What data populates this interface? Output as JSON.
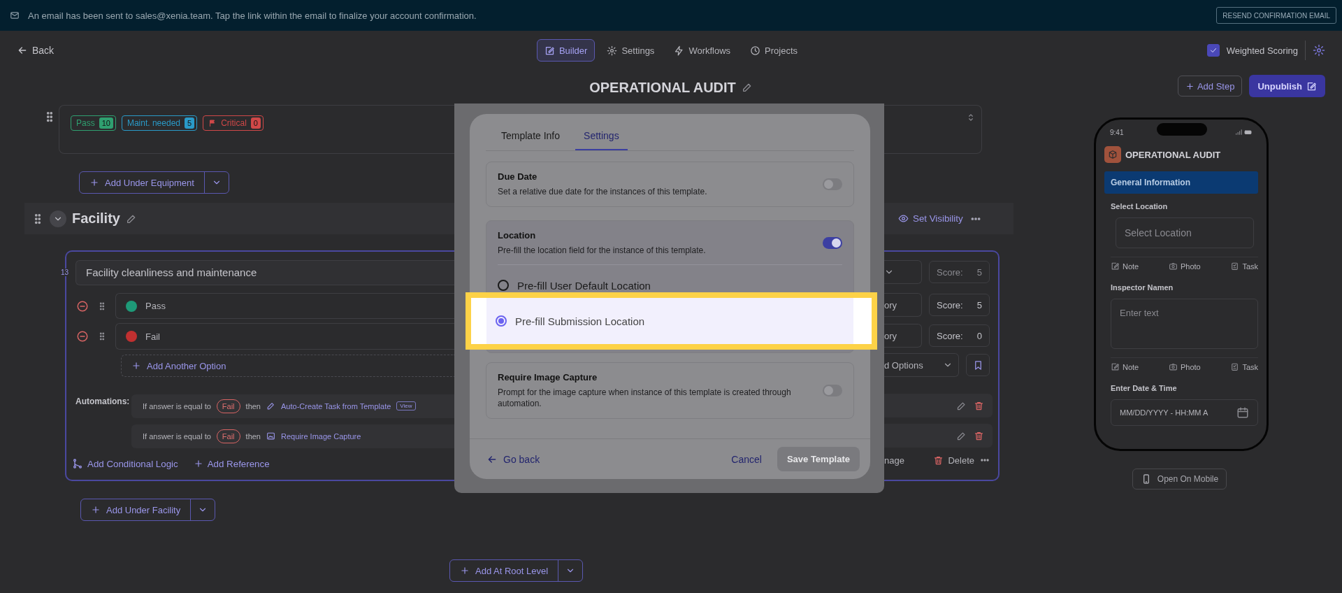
{
  "banner": {
    "message": "An email has been sent to sales@xenia.team. Tap the link within the email to finalize your account confirmation.",
    "action": "RESEND CONFIRMATION EMAIL"
  },
  "header": {
    "back": "Back",
    "tabs": [
      {
        "label": "Builder",
        "selected": true,
        "kind": "builder"
      },
      {
        "label": "Settings",
        "selected": false,
        "kind": "settings"
      },
      {
        "label": "Workflows",
        "selected": false,
        "kind": "workflows"
      },
      {
        "label": "Projects",
        "selected": false,
        "kind": "projects"
      }
    ],
    "weighted_scoring": {
      "label": "Weighted Scoring",
      "checked": true
    }
  },
  "title": "OPERATIONAL AUDIT",
  "actions": {
    "add_step": "Add Step",
    "unpublish": "Unpublish"
  },
  "equipment": {
    "chips": [
      {
        "label": "Pass",
        "count": "10",
        "color": "#2fa070"
      },
      {
        "label": "Maint. needed",
        "count": "5",
        "color": "#2a9ac8"
      },
      {
        "label": "Critical",
        "count": "0",
        "color": "#d04848"
      }
    ],
    "add_button": "Add Under Equipment"
  },
  "section": {
    "title": "Facility",
    "visibility": "Set Visibility",
    "question": {
      "number": "13",
      "text": "Facility cleanliness and maintenance",
      "score_label": "Score:",
      "score": "5",
      "options": [
        {
          "label": "Pass",
          "color": "#1e9a78",
          "category": "ory",
          "score_label": "Score:",
          "score": "5"
        },
        {
          "label": "Fail",
          "color": "#c03030",
          "category": "ory",
          "score_label": "Score:",
          "score": "0"
        }
      ],
      "add_option": "Add Another Option",
      "options_menu": "d Options",
      "automations_label": "Automations:",
      "automations": [
        {
          "kind": "task",
          "condition": "If answer is equal to",
          "value": "Fail",
          "then": "then",
          "action": "Auto-Create Task from Template",
          "view": "View"
        },
        {
          "kind": "image",
          "condition": "If answer is equal to",
          "value": "Fail",
          "then": "then",
          "action": "Require Image Capture"
        }
      ],
      "conditional": "Add Conditional Logic",
      "reference": "Add Reference",
      "manage": "nage",
      "delete": "Delete"
    },
    "add_button": "Add Under Facility"
  },
  "root_button": "Add At Root Level",
  "dialog": {
    "tabs": [
      {
        "label": "Template Info",
        "selected": false
      },
      {
        "label": "Settings",
        "selected": true
      }
    ],
    "settings": [
      {
        "kind": "toggle",
        "title": "Due Date",
        "description": "Set a relative due date for the instances of this template.",
        "on": false
      },
      {
        "kind": "location",
        "title": "Location",
        "description": "Pre-fill the location field for the instance of this template.",
        "on": true,
        "options": [
          {
            "label": "Pre-fill User Default Location",
            "selected": false
          },
          {
            "label": "Pre-fill Submission Location",
            "selected": true
          }
        ]
      },
      {
        "kind": "toggle",
        "title": "Require Image Capture",
        "description": "Prompt for the image capture when instance of this template is created through automation.",
        "on": false
      }
    ],
    "go_back": "Go back",
    "cancel": "Cancel",
    "save": {
      "label": "Save Template",
      "disabled": true
    }
  },
  "preview": {
    "time": "9:41",
    "title": "OPERATIONAL AUDIT",
    "section": "General Information",
    "fields": [
      {
        "kind": "select",
        "label": "Select Location",
        "placeholder": "Select Location",
        "actions": [
          "Note",
          "Photo",
          "Task"
        ]
      },
      {
        "kind": "text",
        "label": "Inspector Namen",
        "placeholder": "Enter text",
        "actions": [
          "Note",
          "Photo",
          "Task"
        ]
      },
      {
        "kind": "datetime",
        "label": "Enter Date & Time",
        "placeholder": "MM/DD/YYYY - HH:MM A"
      }
    ],
    "open_mobile": "Open On Mobile"
  }
}
